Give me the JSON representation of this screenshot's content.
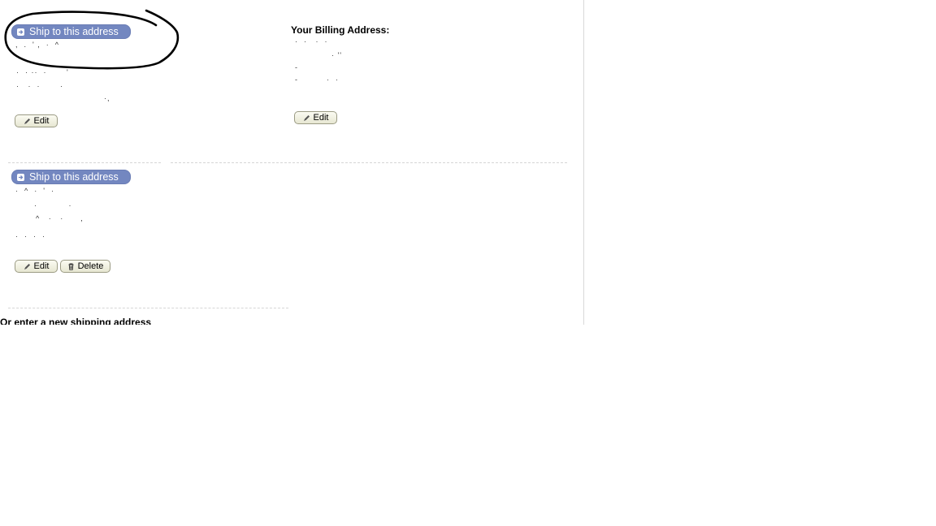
{
  "address_1": {
    "ship_label": "Ship to this address",
    "edit_label": "Edit"
  },
  "billing": {
    "heading": "Your Billing Address:",
    "edit_label": "Edit"
  },
  "address_2": {
    "ship_label": "Ship to this address",
    "edit_label": "Edit",
    "delete_label": "Delete"
  },
  "new_address": {
    "prompt": "Or enter a new shipping address"
  },
  "colors": {
    "ship_button": "#7387c0",
    "annotation_stroke": "#000000"
  }
}
